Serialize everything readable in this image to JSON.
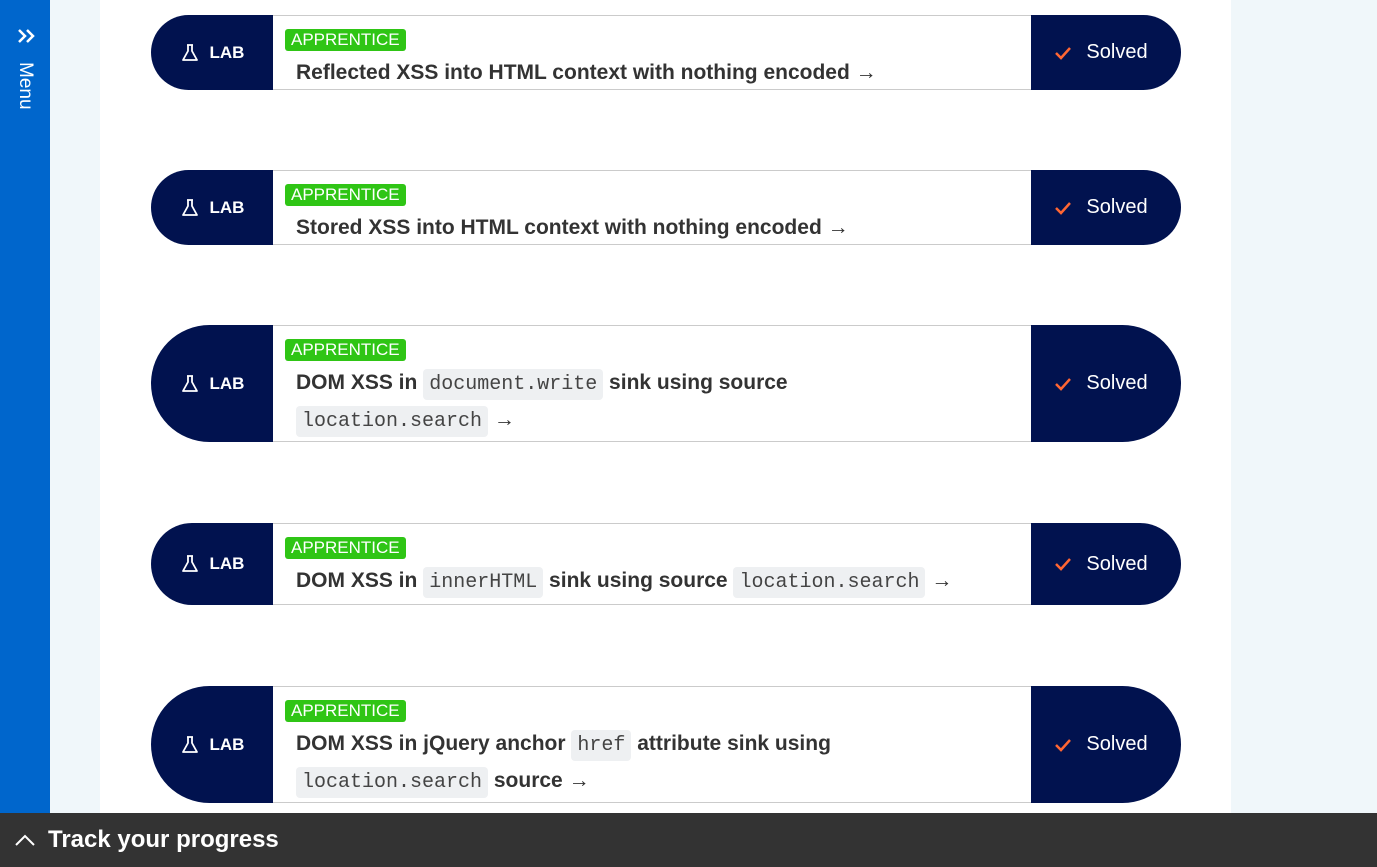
{
  "sidebar": {
    "menu_label": "Menu"
  },
  "labs": [
    {
      "type_label": "LAB",
      "level": "APPRENTICE",
      "title_parts": [
        "Reflected XSS into HTML context with nothing encoded →"
      ],
      "status": "Solved"
    },
    {
      "type_label": "LAB",
      "level": "APPRENTICE",
      "title_parts": [
        "Stored XSS into HTML context with nothing encoded →"
      ],
      "status": "Solved"
    },
    {
      "type_label": "LAB",
      "level": "APPRENTICE",
      "title_parts": [
        "DOM XSS in ",
        "document.write",
        " sink using source ",
        "location.search",
        " →"
      ],
      "status": "Solved"
    },
    {
      "type_label": "LAB",
      "level": "APPRENTICE",
      "title_parts": [
        "DOM XSS in ",
        "innerHTML",
        " sink using source ",
        "location.search",
        " →"
      ],
      "status": "Solved"
    },
    {
      "type_label": "LAB",
      "level": "APPRENTICE",
      "title_parts": [
        "DOM XSS in jQuery anchor ",
        "href",
        " attribute sink using ",
        "location.search",
        " source →"
      ],
      "status": "Solved"
    }
  ],
  "footer": {
    "label": "Track your progress"
  },
  "colors": {
    "sidebar": "#0066cc",
    "lab_dark": "#01124f",
    "badge_green": "#2fc515",
    "check_orange": "#ff6633",
    "footer_bg": "#333333"
  }
}
